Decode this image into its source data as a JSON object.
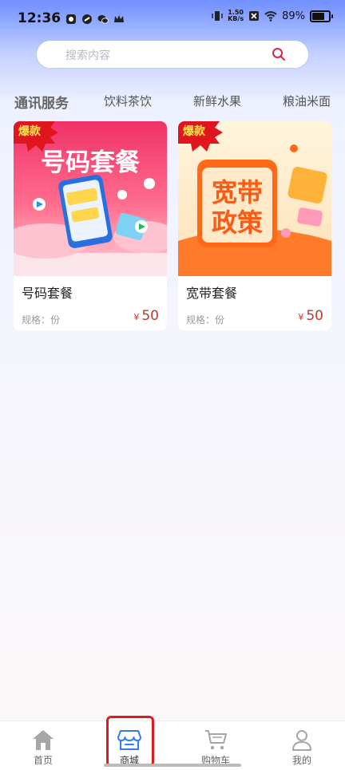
{
  "status_bar": {
    "time": "12:36",
    "net_speed_value": "1.50",
    "net_speed_unit": "KB/s",
    "battery": "89%"
  },
  "search": {
    "placeholder": "搜索内容"
  },
  "categories": [
    {
      "label": "通讯服务",
      "active": true
    },
    {
      "label": "饮料茶饮",
      "active": false
    },
    {
      "label": "新鲜水果",
      "active": false
    },
    {
      "label": "粮油米面",
      "active": false
    }
  ],
  "products": [
    {
      "badge": "爆款",
      "image_title": "号码套餐",
      "title": "号码套餐",
      "spec": "规格：份",
      "currency": "¥",
      "price": "50"
    },
    {
      "badge": "爆款",
      "image_title_line1": "宽带",
      "image_title_line2": "政策",
      "title": "宽带套餐",
      "spec": "规格：份",
      "currency": "¥",
      "price": "50"
    }
  ],
  "nav": [
    {
      "label": "首页",
      "icon": "home-icon"
    },
    {
      "label": "商城",
      "icon": "store-icon",
      "active": true
    },
    {
      "label": "购物车",
      "icon": "cart-icon"
    },
    {
      "label": "我的",
      "icon": "user-icon"
    }
  ],
  "colors": {
    "price": "#c0392b",
    "accent": "#e01b1b",
    "active_nav": "#2f7cf6"
  }
}
